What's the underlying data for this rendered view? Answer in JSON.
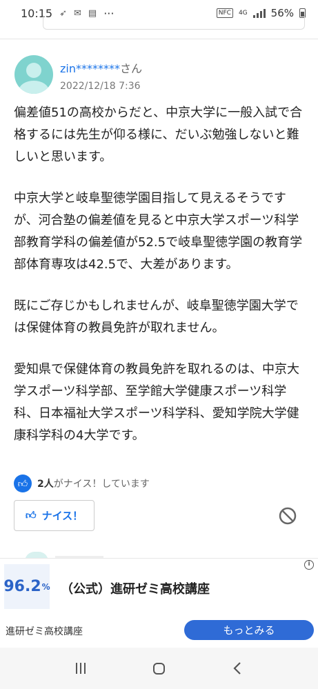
{
  "status_bar": {
    "time": "10:15",
    "notif_icons": [
      "bird-icon",
      "mail-icon",
      "message-icon"
    ],
    "more": "···",
    "nfc": "NFC",
    "network": "4G",
    "battery": "56%"
  },
  "answer": {
    "username": "zin********",
    "honorific": "さん",
    "date": "2022/12/18 7:36",
    "paragraphs": [
      "偏差値51の高校からだと、中京大学に一般入試で合格するには先生が仰る様に、だいぶ勉強しないと難しいと思います。",
      "中京大学と岐阜聖徳学園目指して見えるそうですが、河合塾の偏差値を見ると中京大学スポーツ科学部教育学科の偏差値が52.5で岐阜聖徳学園の教育学部体育専攻は42.5で、大差があります。",
      "既にご存じかもしれませんが、岐阜聖徳学園大学では保健体育の教員免許が取れません。",
      "愛知県で保健体育の教員免許を取れるのは、中京大学スポーツ科学部、至学館大学健康スポーツ科学科、日本福祉大学スポーツ科学科、愛知学院大学健康科学科の4大学です。"
    ],
    "nice_count": "2人",
    "nice_suffix": "がナイス！しています",
    "nice_button_label": "ナイス！"
  },
  "ad": {
    "thumb_number": "96.2",
    "thumb_unit": "%",
    "title": "（公式）進研ゼミ高校講座",
    "sponsor": "進研ゼミ高校講座",
    "cta": "もっとみる",
    "info_icon": "i"
  },
  "colors": {
    "accent": "#1a73e8",
    "avatar": "#7fd3ce",
    "ad_button": "#2f6bd6"
  }
}
